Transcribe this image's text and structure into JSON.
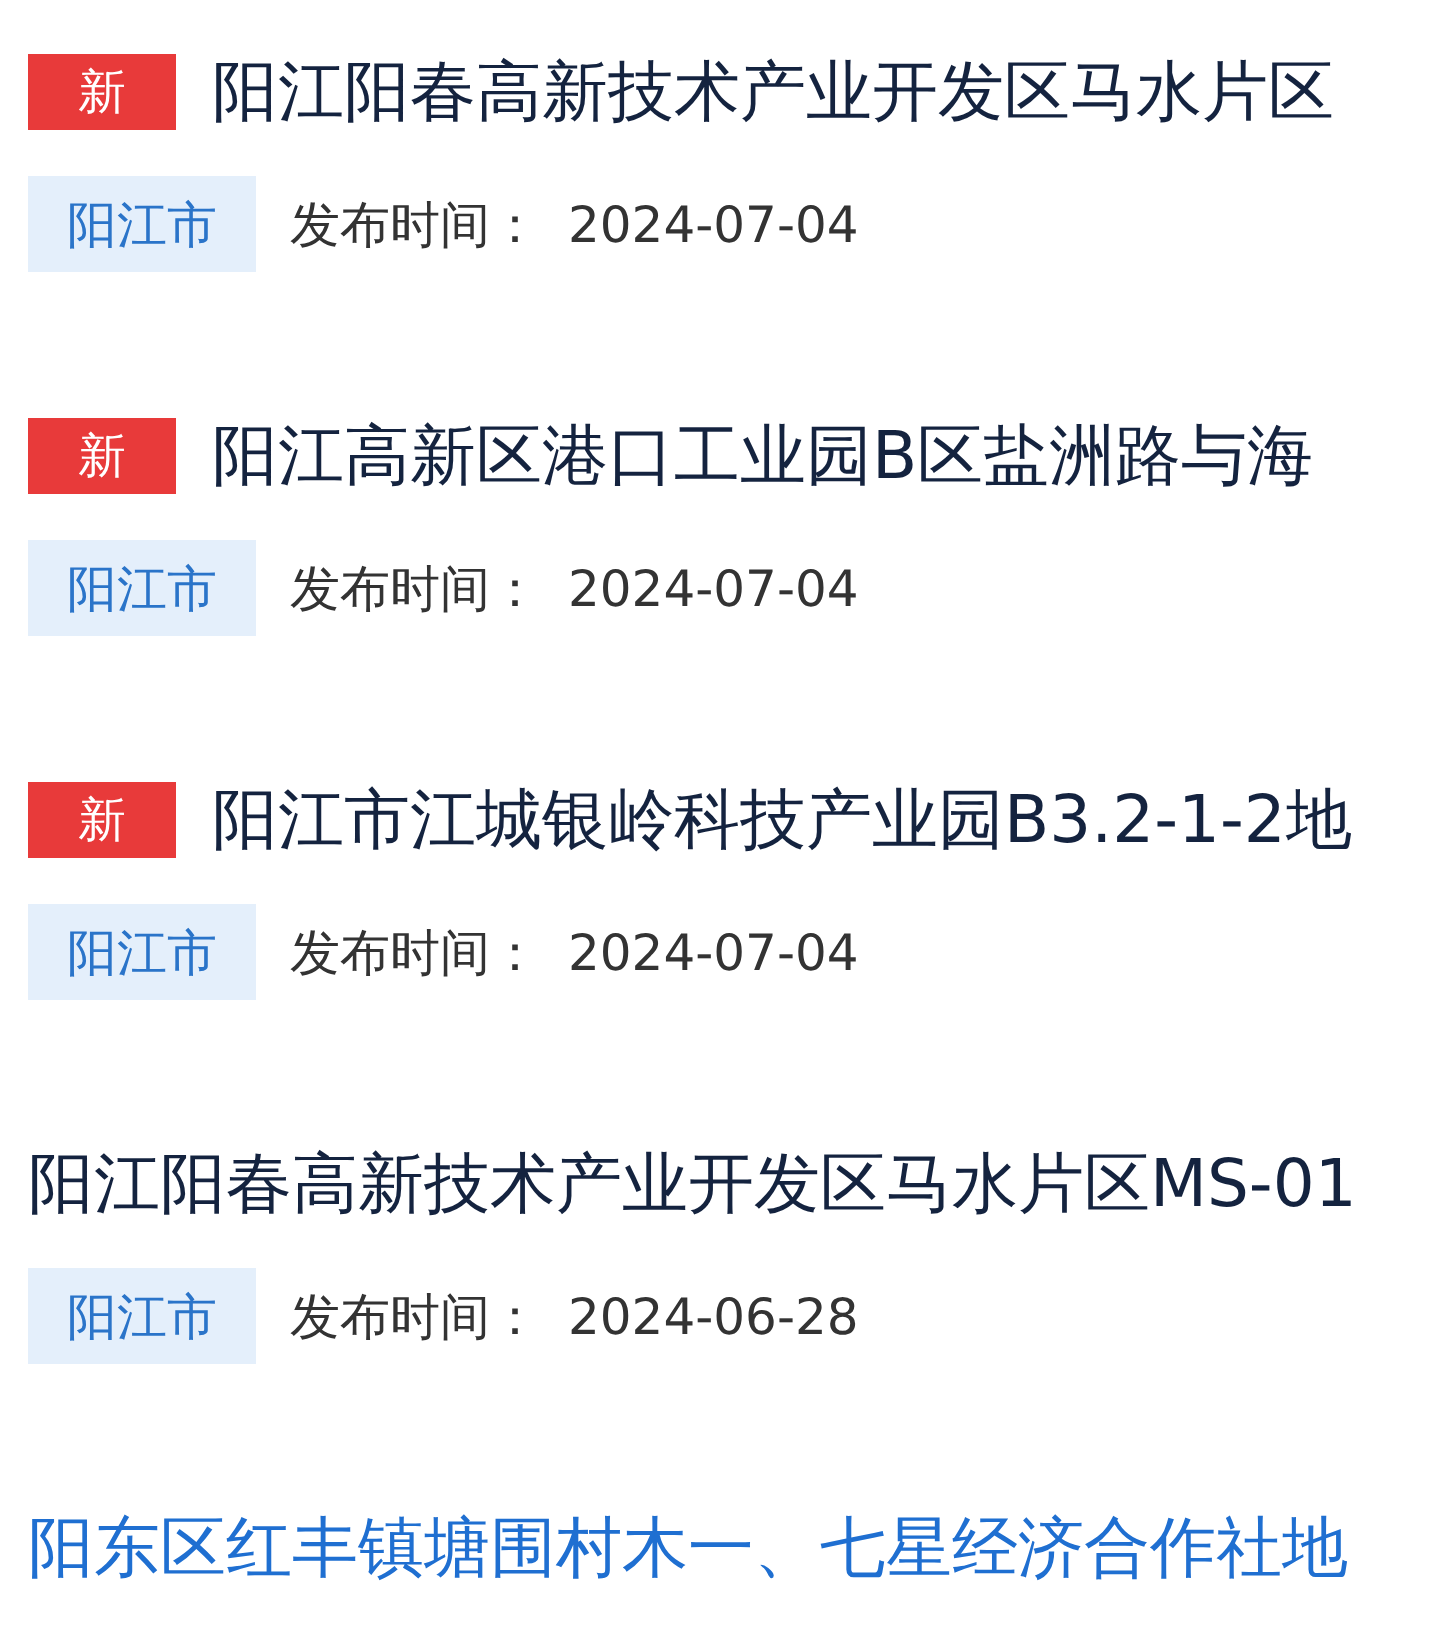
{
  "items": [
    {
      "badge": "新",
      "highlighted": false,
      "title": "阳江阳春高新技术产业开发区马水片区",
      "region": "阳江市",
      "date_label": "发布时间：",
      "date": "2024-07-04"
    },
    {
      "badge": "新",
      "highlighted": false,
      "title": "阳江高新区港口工业园B区盐洲路与海",
      "region": "阳江市",
      "date_label": "发布时间：",
      "date": "2024-07-04"
    },
    {
      "badge": "新",
      "highlighted": false,
      "title": "阳江市江城银岭科技产业园B3.2-1-2地",
      "region": "阳江市",
      "date_label": "发布时间：",
      "date": "2024-07-04"
    },
    {
      "highlighted": false,
      "title": "阳江阳春高新技术产业开发区马水片区MS-01",
      "region": "阳江市",
      "date_label": "发布时间：",
      "date": "2024-06-28"
    },
    {
      "highlighted": true,
      "title": "阳东区红丰镇塘围村木一、七星经济合作社地"
    }
  ]
}
